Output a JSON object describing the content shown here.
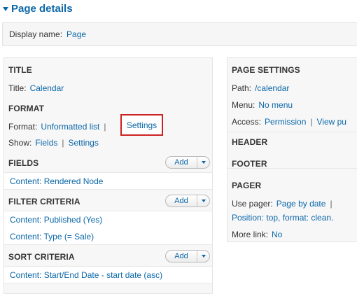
{
  "page_details": {
    "heading": "Page details"
  },
  "display": {
    "label": "Display name:",
    "value": "Page"
  },
  "left": {
    "title": {
      "heading": "TITLE",
      "label": "Title:",
      "value": "Calendar"
    },
    "format": {
      "heading": "FORMAT",
      "format_label": "Format:",
      "format_value": "Unformatted list",
      "format_settings": "Settings",
      "show_label": "Show:",
      "show_value": "Fields",
      "show_settings": "Settings"
    },
    "fields": {
      "heading": "FIELDS",
      "add": "Add",
      "items": [
        "Content: Rendered Node"
      ]
    },
    "filter": {
      "heading": "FILTER CRITERIA",
      "add": "Add",
      "items": [
        "Content: Published (Yes)",
        "Content: Type (= Sale)"
      ]
    },
    "sort": {
      "heading": "SORT CRITERIA",
      "add": "Add",
      "items": [
        "Content: Start/End Date - start date (asc)"
      ]
    }
  },
  "right": {
    "page_settings": {
      "heading": "PAGE SETTINGS",
      "path_label": "Path:",
      "path_value": "/calendar",
      "menu_label": "Menu:",
      "menu_value": "No menu",
      "access_label": "Access:",
      "access_value": "Permission",
      "access_view": "View pu"
    },
    "header": {
      "heading": "HEADER"
    },
    "footer": {
      "heading": "FOOTER"
    },
    "pager": {
      "heading": "PAGER",
      "use_label": "Use pager:",
      "use_value": "Page by date",
      "position": "Position: top, format: clean.",
      "more_label": "More link:",
      "more_value": "No"
    }
  },
  "separator": "|"
}
